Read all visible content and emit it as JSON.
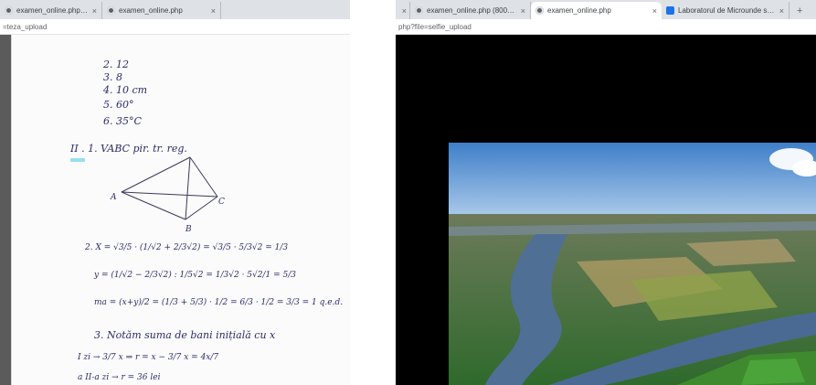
{
  "left_window": {
    "tabs": [
      {
        "title": "examen_online.php (800×522)",
        "close": "×",
        "active": false
      },
      {
        "title": "examen_online.php",
        "close": "×",
        "active": false
      }
    ],
    "url": "=teza_upload",
    "document": {
      "answers": [
        "2. 12",
        "3. 8",
        "4. 10 cm",
        "5. 60°",
        "6. 35°C"
      ],
      "section_heading": "II . 1.  VABC pir. tr. reg.",
      "figure_labels": {
        "a": "A",
        "c": "C",
        "b": "B"
      },
      "line_x": "2.  X = √3/5 · (1/√2 + 2/3√2) = √3/5 · 5/3√2 = 1/3",
      "line_y": "y = (1/√2 − 2/3√2) : 1/5√2 = 1/3√2 · 5√2/1 = 5/3",
      "line_ma": "ma = (x+y)/2 = (1/3 + 5/3) · 1/2 = 6/3 · 1/2 = 3/3 = 1  q.e.d.",
      "line_3": "3.  Notăm suma de bani inițială cu x",
      "line_day1": "I zi → 3/7 x ⇒ r = x − 3/7 x = 4x/7",
      "line_day2": "a II-a zi → r = 36 lei"
    }
  },
  "right_window": {
    "tabs": [
      {
        "title": "examen_online.php (800×522)",
        "close": "×",
        "active": false,
        "favicon": "chrome"
      },
      {
        "title": "examen_online.php",
        "close": "×",
        "active": true,
        "favicon": "chrome"
      },
      {
        "title": "Laboratorul de Microunde si Opt",
        "close": "×",
        "active": false,
        "favicon": "lab"
      }
    ],
    "left_close": "×",
    "new_tab": "+",
    "url": "php?file=selfie_upload"
  },
  "colors": {
    "tabstrip": "#dee1e6",
    "ink": "#2b2b6a",
    "highlight": "#7fd7f0"
  }
}
